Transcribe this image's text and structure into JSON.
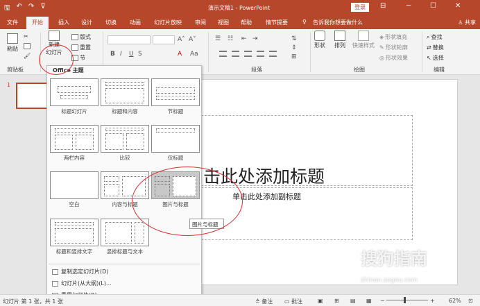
{
  "window": {
    "title": "演示文稿1 - PowerPoint",
    "login_label": "登录",
    "qat_icons": [
      "save-icon",
      "undo-icon",
      "redo-icon",
      "customize-icon"
    ]
  },
  "tabs": [
    "文件",
    "开始",
    "插入",
    "设计",
    "切换",
    "动画",
    "幻灯片放映",
    "审阅",
    "视图",
    "帮助",
    "情节提要"
  ],
  "active_tab": "开始",
  "tell_me": "告诉我你想要做什么",
  "share_label": "共享",
  "ribbon": {
    "clipboard": {
      "paste": "粘贴",
      "group": "剪贴板"
    },
    "slides": {
      "new_slide_line1": "新建",
      "new_slide_line2": "幻灯片",
      "layout": "版式",
      "reset": "重置",
      "section": "节"
    },
    "paragraph": {
      "group": "段落"
    },
    "drawing": {
      "shapes": "形状",
      "arrange": "排列",
      "quick_styles": "快速样式",
      "fill": "形状填充",
      "outline": "形状轮廓",
      "effect": "形状效果",
      "group": "绘图"
    },
    "editing": {
      "find": "查找",
      "replace": "替换",
      "select": "选择",
      "group": "编辑"
    }
  },
  "dropdown": {
    "header": "Office 主题",
    "layouts": [
      "标题幻灯片",
      "标题和内容",
      "节标题",
      "两栏内容",
      "比较",
      "仅标题",
      "空白",
      "内容与标题",
      "图片与标题",
      "标题和竖排文字",
      "竖排标题与文本"
    ],
    "selected": "图片与标题",
    "tooltip": "图片与标题",
    "menu": [
      "复制选定幻灯片(D)",
      "幻灯片(从大纲)(L)...",
      "重用幻灯片(R)..."
    ]
  },
  "slide_panel": {
    "number": "1"
  },
  "slide": {
    "title_placeholder": "单击此处添加标题",
    "title_visible": "击此处添加标题",
    "subtitle_placeholder": "单击此处添加副标题"
  },
  "status": {
    "slide_info": "幻灯片 第 1 张，共 1 张",
    "notes": "备注",
    "comments": "批注",
    "zoom": "62%",
    "zoom_fraction": 0.62
  },
  "watermark": {
    "brand": "搜狗指南",
    "url": "zhinan.sogou.com"
  },
  "annotation_color": "#d63030",
  "accent": "#b7472a"
}
